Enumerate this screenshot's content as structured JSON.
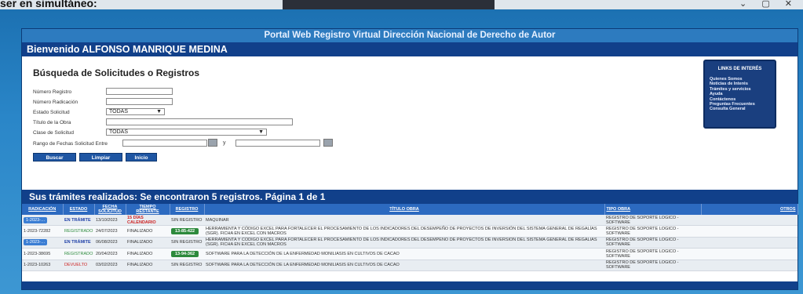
{
  "browser": {
    "caption": "ser en simultáneo:",
    "window_controls": "⌄ ▢ ✕"
  },
  "portal_title": "Portal Web Registro Virtual Dirección Nacional de Derecho de Autor",
  "welcome": "Bienvenido ALFONSO MANRIQUE MEDINA",
  "search": {
    "title": "Búsqueda de Solicitudes o Registros",
    "labels": {
      "numero_registro": "Número Registro",
      "numero_radicacion": "Número Radicación",
      "estado_solicitud": "Estado Solicitud",
      "titulo_obra": "Título de la Obra",
      "clase_solicitud": "Clase de Solicitud",
      "rango_fechas": "Rango de Fechas Solicitud",
      "entre": "Entre",
      "y": "y"
    },
    "values": {
      "numero_registro": "",
      "numero_radicacion": "",
      "estado_solicitud": "TODAS",
      "titulo_obra": "",
      "clase_solicitud": "TODAS",
      "fecha_desde": "",
      "fecha_hasta": ""
    },
    "buttons": {
      "buscar": "Buscar",
      "limpiar": "Limpiar",
      "inicio": "Inicio"
    }
  },
  "links": {
    "title": "LINKS DE INTERÉS",
    "items": [
      "Quienes Somos",
      "Noticias de Interés",
      "Trámites y servicios",
      "Ayuda",
      "Contáctenos",
      "Preguntas Frecuentes",
      "Consulta General"
    ]
  },
  "results": {
    "title": "Sus trámites realizados:  Se encontraron 5 registros. Página 1 de 1",
    "headers": {
      "radicacion": "RADICACIÓN",
      "estado": "ESTADO",
      "fecha": "FECHA SOLICITUD",
      "tiempo": "TIEMPO RESTANTE",
      "registro": "REGISTRO",
      "titulo": "TÍTULO OBRA",
      "tipo": "TIPO OBRA",
      "otros": "OTROS"
    },
    "rows": [
      {
        "radicacion": "1-2023-…",
        "estado": "EN TRÁMITE",
        "fecha": "13/10/2023",
        "tiempo": "15 DÍAS CALENDARIO",
        "registro": "SIN REGISTRO",
        "titulo": "MAQUINAR",
        "tipo": "REGISTRO DE SOPORTE LOGICO - SOFTWARE"
      },
      {
        "radicacion": "1-2023-72282",
        "estado": "REGISTRADO",
        "fecha": "24/07/2023",
        "tiempo": "FINALIZADO",
        "registro": "13-85-422",
        "titulo": "HERRAMIENTA Y CÓDIGO EXCEL PARA FORTALECER EL PROCESAMIENTO DE LOS INDICADORES DEL DESEMPEÑO DE PROYECTOS DE INVERSIÓN DEL SISTEMA GENERAL DE REGALÍAS (SGR). FICHA EN EXCEL CON MACROS",
        "tipo": "REGISTRO DE SOPORTE LOGICO - SOFTWARE"
      },
      {
        "radicacion": "1-2023-…",
        "estado": "EN TRÁMITE",
        "fecha": "06/08/2023",
        "tiempo": "FINALIZADO",
        "registro": "SIN REGISTRO",
        "titulo": "HERRAMIENTA Y CÓDIGO EXCEL PARA FORTALECER EL PROCESAMIENTO DE LOS INDICADORES DEL DESEMPEÑO DE PROYECTOS DE INVERSIÓN DEL SISTEMA GENERAL DE REGALÍAS (SGR). FICHA EN EXCEL CON MACROS",
        "tipo": "REGISTRO DE SOPORTE LOGICO - SOFTWARE"
      },
      {
        "radicacion": "1-2023-38695",
        "estado": "REGISTRADO",
        "fecha": "20/04/2023",
        "tiempo": "FINALIZADO",
        "registro": "13-94-362",
        "titulo": "SOFTWARE PARA LA DETECCIÓN DE LA ENFERMEDAD MONILIASIS EN CULTIVOS DE CACAO",
        "tipo": "REGISTRO DE SOPORTE LOGICO - SOFTWARE"
      },
      {
        "radicacion": "1-2023-10263",
        "estado": "DEVUELTO",
        "fecha": "03/02/2023",
        "tiempo": "FINALIZADO",
        "registro": "SIN REGISTRO",
        "titulo": "SOFTWARE PARA LA DETECCIÓN DE LA ENFERMEDAD MONILIASIS EN CULTIVOS DE CACAO",
        "tipo": "REGISTRO DE SOPORTE LOGICO - SOFTWARE"
      }
    ]
  },
  "colors": {
    "header_blue": "#11408a",
    "table_header": "#2c6ac0",
    "status_green": "#2d8a3c",
    "status_red": "#cc2222"
  }
}
